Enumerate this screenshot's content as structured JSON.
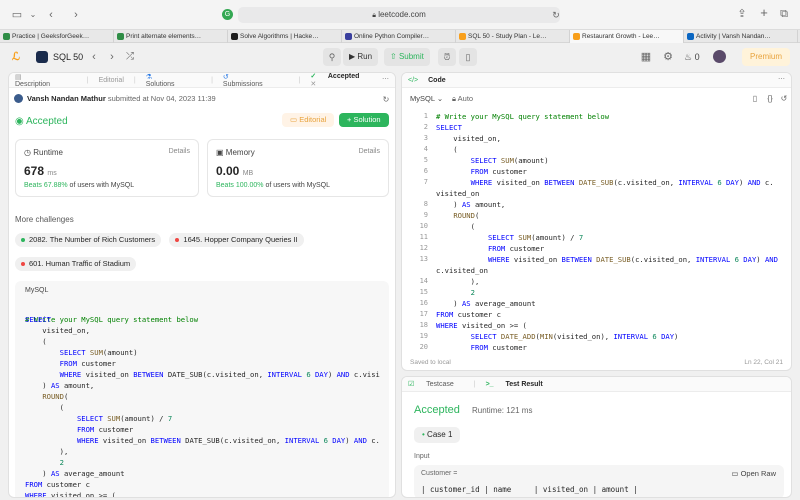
{
  "browser": {
    "url": "leetcode.com",
    "tabs": [
      {
        "label": "Practice | GeeksforGeek…",
        "color": "#2f8d46"
      },
      {
        "label": "Print alternate elements…",
        "color": "#2f8d46"
      },
      {
        "label": "Solve Algorithms | Hacke…",
        "color": "#1e1e1e"
      },
      {
        "label": "Online Python Compiler…",
        "color": "#3a3f9e"
      },
      {
        "label": "SQL 50 - Study Plan - Le…",
        "color": "#f89f1b"
      },
      {
        "label": "Restaurant Growth - Lee…",
        "color": "#f89f1b"
      },
      {
        "label": "Activity | Vansh Nandan…",
        "color": "#0a66c2"
      }
    ]
  },
  "toolbar": {
    "study_plan": "SQL 50",
    "run": "Run",
    "submit": "Submit",
    "streak": "0",
    "premium": "Premium"
  },
  "left": {
    "tabs": [
      "Description",
      "Editorial",
      "Solutions",
      "Submissions",
      "Accepted"
    ],
    "submitter": "Vansh Nandan Mathur",
    "submitted_text": "submitted at Nov 04, 2023 11:39",
    "status": "Accepted",
    "editorial_btn": "Editorial",
    "solution_btn": "+ Solution",
    "runtime": {
      "label": "Runtime",
      "details": "Details",
      "value": "678",
      "unit": "ms",
      "beats_pct": "Beats 67.88%",
      "beats_rest": "of users with MySQL"
    },
    "memory": {
      "label": "Memory",
      "details": "Details",
      "value": "0.00",
      "unit": "MB",
      "beats_pct": "Beats 100.00%",
      "beats_rest": "of users with MySQL"
    },
    "more_title": "More challenges",
    "challenges": [
      {
        "text": "2082. The Number of Rich Customers",
        "color": "#2db55d"
      },
      {
        "text": "1645. Hopper Company Queries II",
        "color": "#ef4743"
      },
      {
        "text": "601. Human Traffic of Stadium",
        "color": "#ef4743"
      }
    ],
    "code_lang": "MySQL"
  },
  "editor": {
    "title": "Code",
    "language": "MySQL",
    "autosave": "Auto",
    "saved": "Saved to local",
    "cursor": "Ln 22, Col 21"
  },
  "result": {
    "tabs": [
      "Testcase",
      "Test Result"
    ],
    "status": "Accepted",
    "runtime": "Runtime: 121 ms",
    "case": "Case 1",
    "input_label": "Input",
    "table_name": "Customer =",
    "open_raw": "Open Raw",
    "table_header": "| customer_id | name     | visited_on | amount |"
  }
}
